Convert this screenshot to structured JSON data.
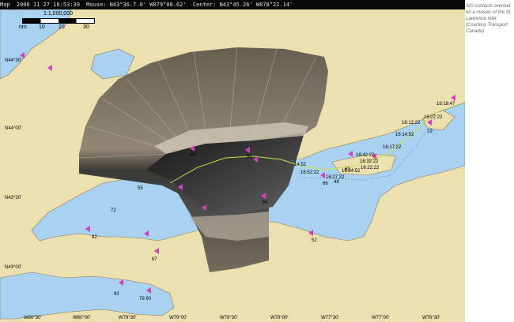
{
  "status_bar": {
    "map_label": "Map",
    "datetime": "2006 11 27 16:53:39",
    "cursor": "Mouse: N43°36.7.0' W079°00.62'",
    "center": "Center: N43°45.26' W078°22.14'"
  },
  "scale": {
    "ratio": "1:1,000,000",
    "unit": "nm",
    "ticks": [
      "10",
      "20",
      "30"
    ]
  },
  "lat_labels": [
    "N44°30'",
    "N44°00'",
    "N43°30'",
    "N43°00'"
  ],
  "lon_labels": [
    "W80°30'",
    "W80°00'",
    "W79°30'",
    "W79°00'",
    "W78°30'",
    "W78°00'",
    "W77°30'",
    "W77°00'",
    "W76°30'"
  ],
  "track_times": [
    "16:18:47",
    "16:07:22",
    "16:12:22",
    "16:14:52",
    "16:17:22",
    "16:42:22",
    "16:52:22",
    "16:27:22",
    "16:22:22",
    "16:24:52",
    "16:32:22",
    "14:52"
  ],
  "vessel_labels": [
    "55",
    "72",
    "82",
    "67",
    "92",
    "79 80",
    "52",
    "66",
    "49",
    "63",
    "19",
    "80",
    "64",
    "86"
  ],
  "caption": "AIS contacts overlaid on a mosaic of the St. Lawrence inlet (Courtesy Transport Canada)",
  "colors": {
    "land": "#ece0b0",
    "water": "#a8d2f0",
    "track": "#c8e040",
    "vessel": "#d040c0"
  }
}
